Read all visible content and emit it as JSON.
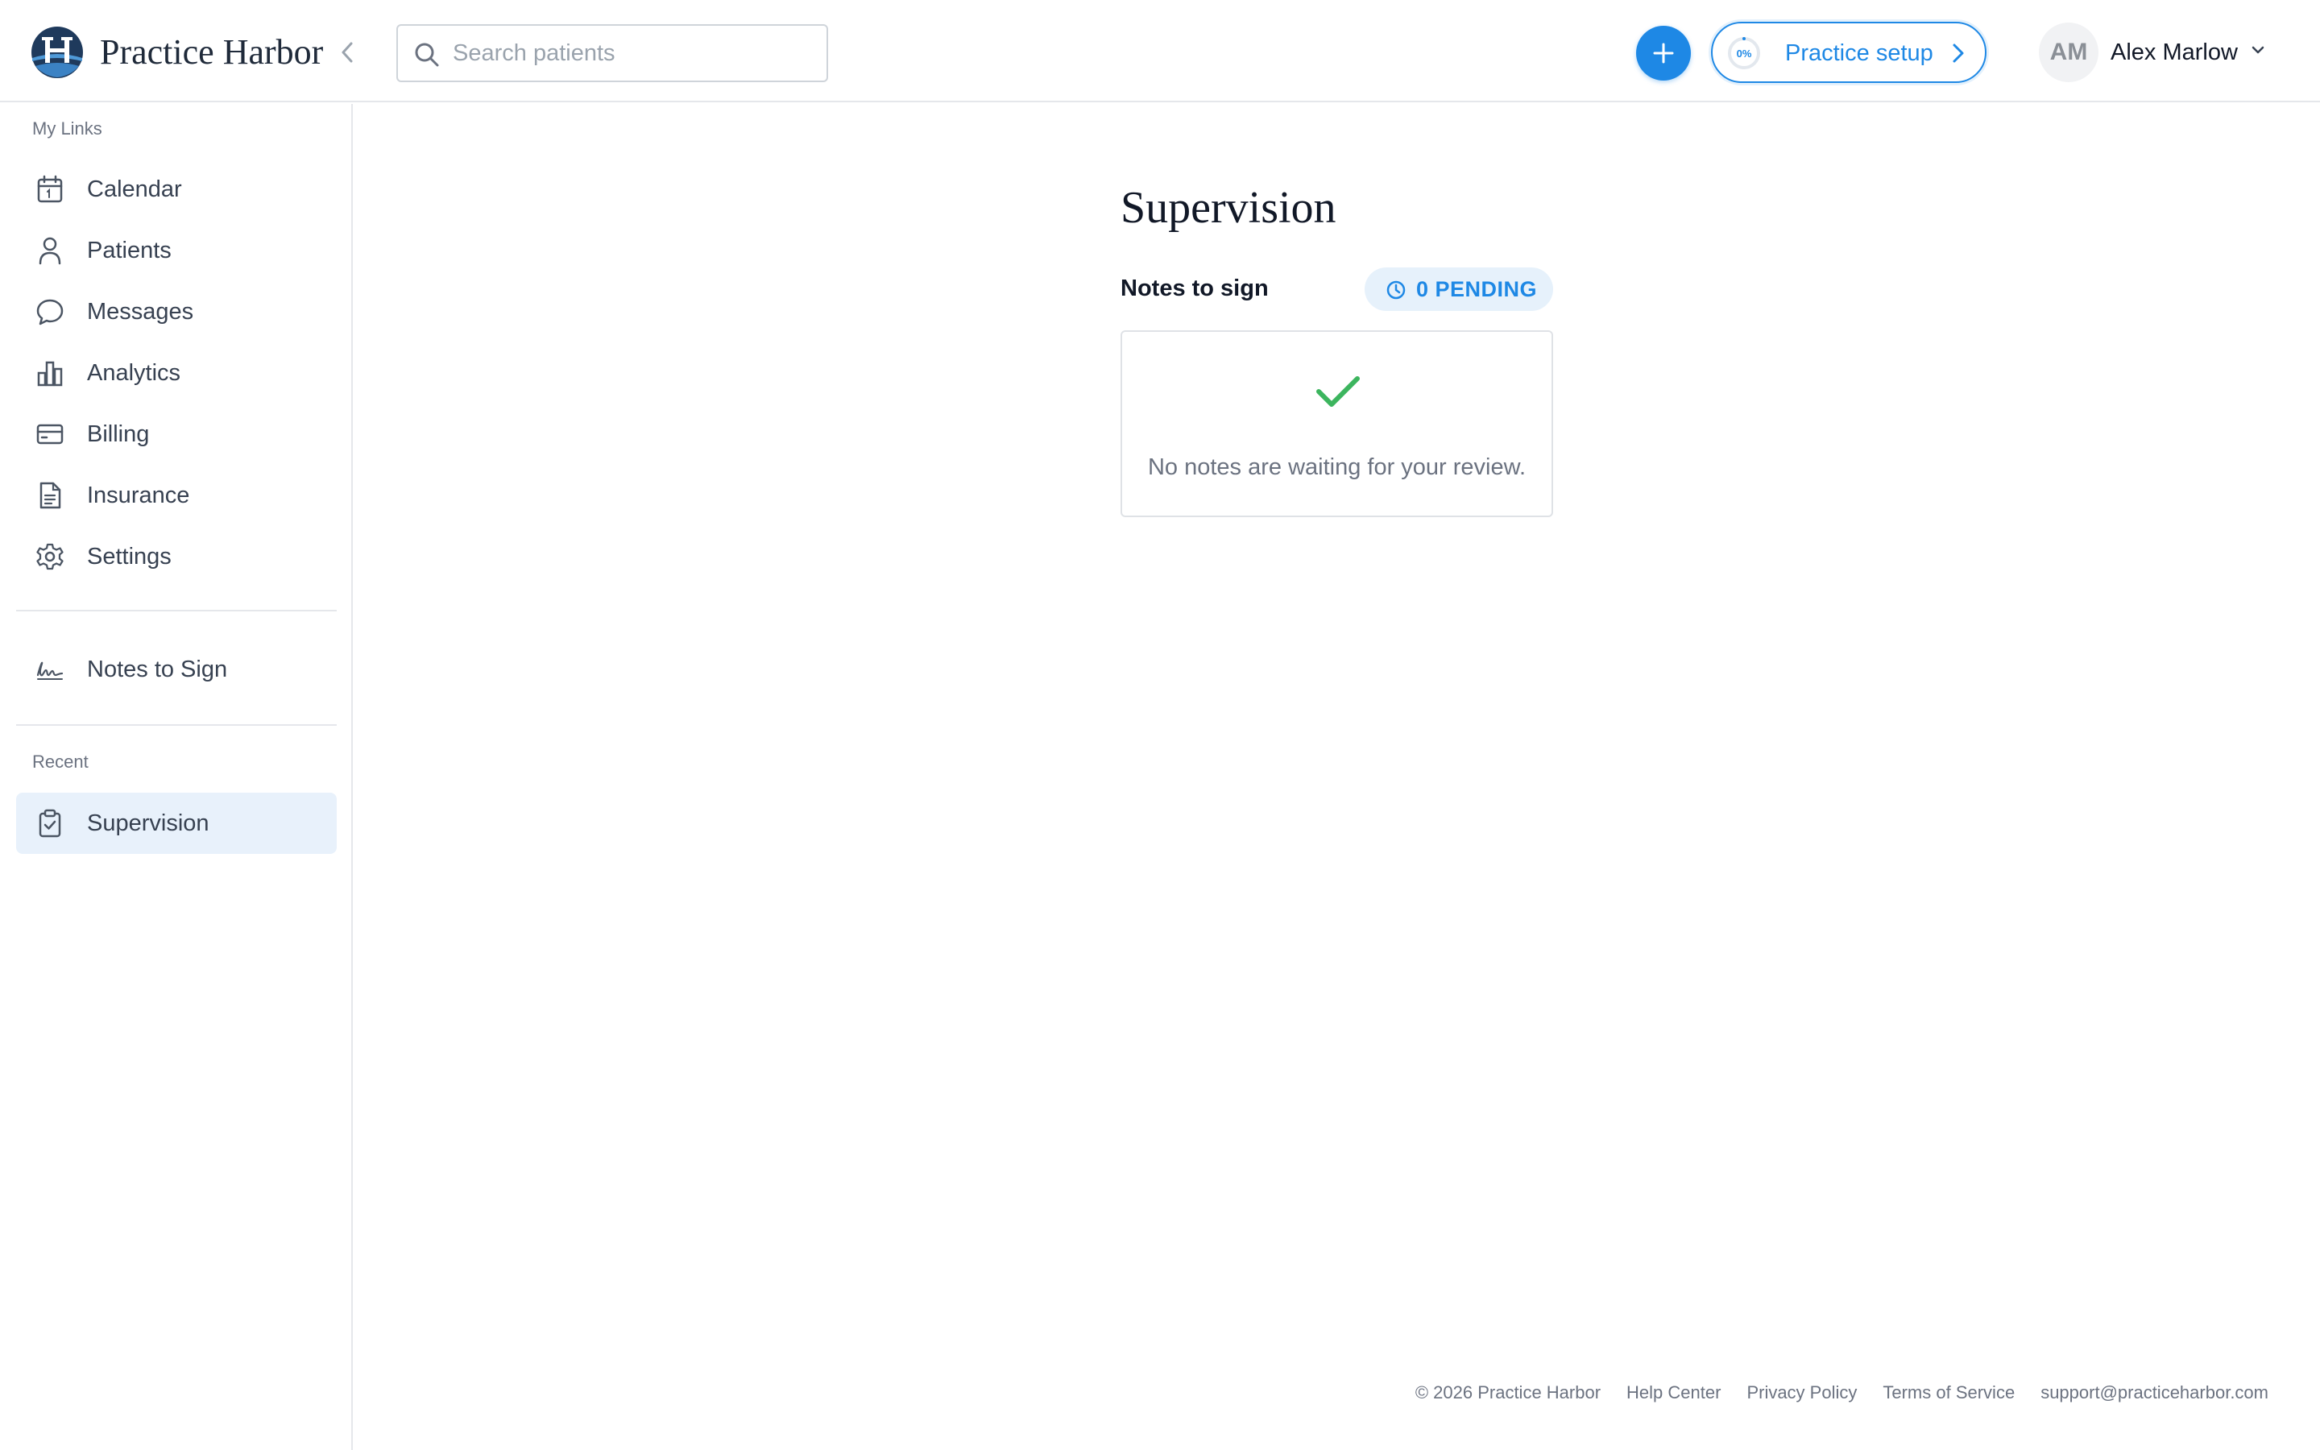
{
  "app": {
    "brand": "Practice Harbor"
  },
  "header": {
    "search_placeholder": "Search patients",
    "setup": {
      "progress_text": "0%",
      "progress_value": 0,
      "label": "Practice setup"
    },
    "user": {
      "initials": "AM",
      "name": "Alex Marlow"
    }
  },
  "sidebar": {
    "my_links_label": "My Links",
    "items": [
      {
        "label": "Calendar",
        "icon": "calendar-icon"
      },
      {
        "label": "Patients",
        "icon": "user-icon"
      },
      {
        "label": "Messages",
        "icon": "message-icon"
      },
      {
        "label": "Analytics",
        "icon": "bar-chart-icon"
      },
      {
        "label": "Billing",
        "icon": "credit-card-icon"
      },
      {
        "label": "Insurance",
        "icon": "document-icon"
      },
      {
        "label": "Settings",
        "icon": "gear-icon"
      }
    ],
    "notes_to_sign": {
      "label": "Notes to Sign",
      "icon": "signature-icon"
    },
    "recent_label": "Recent",
    "recent_items": [
      {
        "label": "Supervision",
        "icon": "clipboard-check-icon",
        "active": true
      }
    ]
  },
  "main": {
    "title": "Supervision",
    "notes_section": {
      "label": "Notes to sign",
      "pending_badge": "0 PENDING",
      "empty_message": "No notes are waiting for your review."
    }
  },
  "footer": {
    "copyright": "© 2026 Practice Harbor",
    "links": [
      "Help Center",
      "Privacy Policy",
      "Terms of Service",
      "support@practiceharbor.com"
    ]
  },
  "colors": {
    "accent": "#1e88e5",
    "success": "#3cb55e",
    "active_bg": "#e8f1fb",
    "brand_dark": "#1f3a5c"
  }
}
